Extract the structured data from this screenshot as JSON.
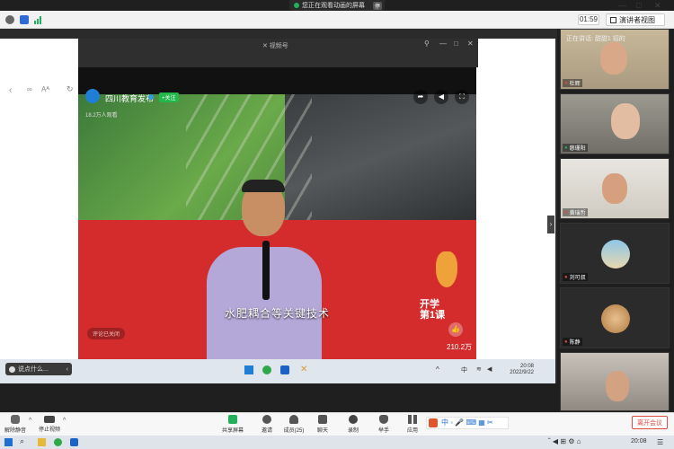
{
  "banner": {
    "text": "您正在观看动画的屏幕",
    "stop_label": "停"
  },
  "titlebar": {
    "timer": "01:59",
    "speaker_view_label": "演讲者视图"
  },
  "video": {
    "channel_name": "四川教育发布",
    "follow_label": "+关注",
    "viewer_count": "18.2万人观看",
    "subtitle": "水肥耦合等关键技术",
    "comment_placeholder": "评论已关闭",
    "likes": "210.2万",
    "watermark_line1": "开学",
    "watermark_line2": "第1课"
  },
  "shared_taskbar": {
    "chat_placeholder": "说点什么...",
    "time": "20:08",
    "date": "2022/9/22",
    "ime": "中"
  },
  "participants": {
    "speaking_label": "正在讲话: 甜甜1 招的",
    "tiles": [
      {
        "name": "杜辉"
      },
      {
        "name": "慈珊阳"
      },
      {
        "name": "黄瑞哲"
      },
      {
        "name": "刘可叔"
      },
      {
        "name": "陈静"
      },
      {
        "name": ""
      }
    ]
  },
  "toolbar": {
    "mute_label": "解除静音",
    "video_label": "停止视频",
    "share_label": "共享屏幕",
    "participants_label": "邀请",
    "members_label": "成员(25)",
    "chat_label": "聊天",
    "record_label": "录制",
    "raise_label": "举手",
    "apps_label": "应用",
    "leave_label": "离开会议"
  },
  "os_taskbar": {
    "time": "20:08"
  },
  "colors": {
    "accent_green": "#20b84a",
    "leave_red": "#e04a3f",
    "stage_red": "#d42c2c"
  }
}
